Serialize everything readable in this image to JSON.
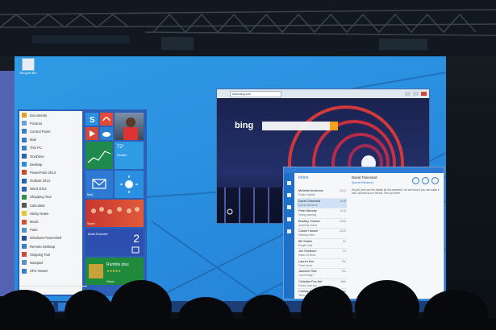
{
  "desktop": {
    "icon_label": "Recycle Bin"
  },
  "start_menu": {
    "items": [
      {
        "label": "Documents",
        "color": "#e3a021"
      },
      {
        "label": "Pictures",
        "color": "#6aa0d8"
      },
      {
        "label": "Control Panel",
        "color": "#3a7fc8"
      },
      {
        "label": "Mail",
        "color": "#2e7ad2"
      },
      {
        "label": "This PC",
        "color": "#3a7fc8"
      },
      {
        "label": "OneDrive",
        "color": "#2a62b8"
      },
      {
        "label": "Desktop",
        "color": "#2a8fe0"
      },
      {
        "label": "PowerPoint 2013",
        "color": "#c9492d"
      },
      {
        "label": "Outlook 2013",
        "color": "#2a62b8"
      },
      {
        "label": "Word 2013",
        "color": "#2a62b8"
      },
      {
        "label": "Shopping Tour",
        "color": "#2e8f4e"
      },
      {
        "label": "Calculator",
        "color": "#555"
      },
      {
        "label": "Sticky Notes",
        "color": "#e8c430"
      },
      {
        "label": "Music",
        "color": "#d0532f"
      },
      {
        "label": "Paint",
        "color": "#5a90c8"
      },
      {
        "label": "Windows PowerShell",
        "color": "#2a4f8e"
      },
      {
        "label": "Remote Desktop",
        "color": "#3a7fc8"
      },
      {
        "label": "Snipping Tool",
        "color": "#d04a3a"
      },
      {
        "label": "Notepad",
        "color": "#5a90c8"
      },
      {
        "label": "XPS Viewer",
        "color": "#3a7fc8"
      }
    ],
    "all_apps": "All Apps",
    "tiles": {
      "weather_temp": "72°",
      "weather_city": "Seattle",
      "sport_caption": "Sport",
      "news_caption": "News",
      "calendar_day": "2",
      "calendar_caption": "Build Keynote",
      "store_title": "Rumble plus",
      "store_rating": "★★★★★",
      "store_caption": "Store",
      "mail_caption": "Mail"
    }
  },
  "ie_window": {
    "address": "www.bing.com",
    "bing_label": "bing"
  },
  "mail_window": {
    "header": "Inbox",
    "messages": [
      {
        "from": "Michelle Anderson",
        "subject": "Project update",
        "time": "12:11"
      },
      {
        "from": "David Tisserand",
        "subject": "Sports Weekend",
        "time": "11:58"
      },
      {
        "from": "Peter Murphy",
        "subject": "Spring planning",
        "time": "11:34"
      },
      {
        "from": "Bradley Chavez",
        "subject": "Quarterly review",
        "time": "10:52"
      },
      {
        "from": "Carole Houser",
        "subject": "Meeting notes",
        "time": "10:12"
      },
      {
        "from": "Bill Statler",
        "subject": "Budget draft",
        "time": "Fri"
      },
      {
        "from": "Joe Shelborn",
        "subject": "Slides for Build",
        "time": "Fri"
      },
      {
        "from": "Lauren Kim",
        "subject": "Travel plans",
        "time": "Thu"
      },
      {
        "from": "Jasmine Rice",
        "subject": "Lunch today?",
        "time": "Thu"
      },
      {
        "from": "Christine Fox-Nel",
        "subject": "Photos from trip",
        "time": "Wed"
      },
      {
        "from": "Chrissy Anderson",
        "subject": "Team update",
        "time": "Wed"
      }
    ],
    "reader": {
      "from": "David Tisserand",
      "subject": "Sports Weekend",
      "body": "Hey all, here are the details for this weekend. Let me know if you can make it and I will add you to the list. See you there."
    }
  },
  "colors": {
    "screen_blue": "#2a8fe0",
    "start_blue": "#2c5fb5",
    "accent_orange": "#f4a21e"
  }
}
